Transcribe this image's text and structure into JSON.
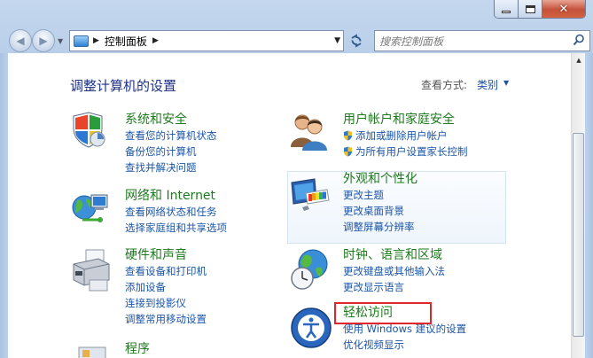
{
  "window": {
    "minimize_label": "",
    "close_glyph": "✕"
  },
  "nav": {
    "breadcrumb": "控制面板",
    "search_placeholder": "搜索控制面板"
  },
  "main": {
    "heading": "调整计算机的设置",
    "view_by_label": "查看方式:",
    "view_by_value": "类别"
  },
  "categories": {
    "system": {
      "title": "系统和安全",
      "links": [
        "查看您的计算机状态",
        "备份您的计算机",
        "查找并解决问题"
      ]
    },
    "network": {
      "title": "网络和 Internet",
      "links": [
        "查看网络状态和任务",
        "选择家庭组和共享选项"
      ]
    },
    "hardware": {
      "title": "硬件和声音",
      "links": [
        "查看设备和打印机",
        "添加设备",
        "连接到投影仪",
        "调整常用移动设置"
      ]
    },
    "programs": {
      "title": "程序"
    },
    "users": {
      "title": "用户帐户和家庭安全",
      "links": [
        "添加或删除用户帐户",
        "为所有用户设置家长控制"
      ]
    },
    "appearance": {
      "title": "外观和个性化",
      "links": [
        "更改主题",
        "更改桌面背景",
        "调整屏幕分辨率"
      ]
    },
    "clock": {
      "title": "时钟、语言和区域",
      "links": [
        "更改键盘或其他输入法",
        "更改显示语言"
      ]
    },
    "ease": {
      "title": "轻松访问",
      "links": [
        "使用 Windows 建议的设置",
        "优化视频显示"
      ]
    }
  },
  "icons": {
    "system": "shield-icon",
    "network": "network-globe-icon",
    "hardware": "printer-icon",
    "users": "users-icon",
    "appearance": "monitor-palette-icon",
    "clock": "globe-clock-icon",
    "ease": "ease-of-access-icon",
    "search": "search-icon",
    "refresh": "refresh-icon"
  },
  "colors": {
    "category_title": "#1e7a1e",
    "link": "#1b55a7",
    "heading": "#1e3287",
    "highlight_box": "#e0262a"
  }
}
